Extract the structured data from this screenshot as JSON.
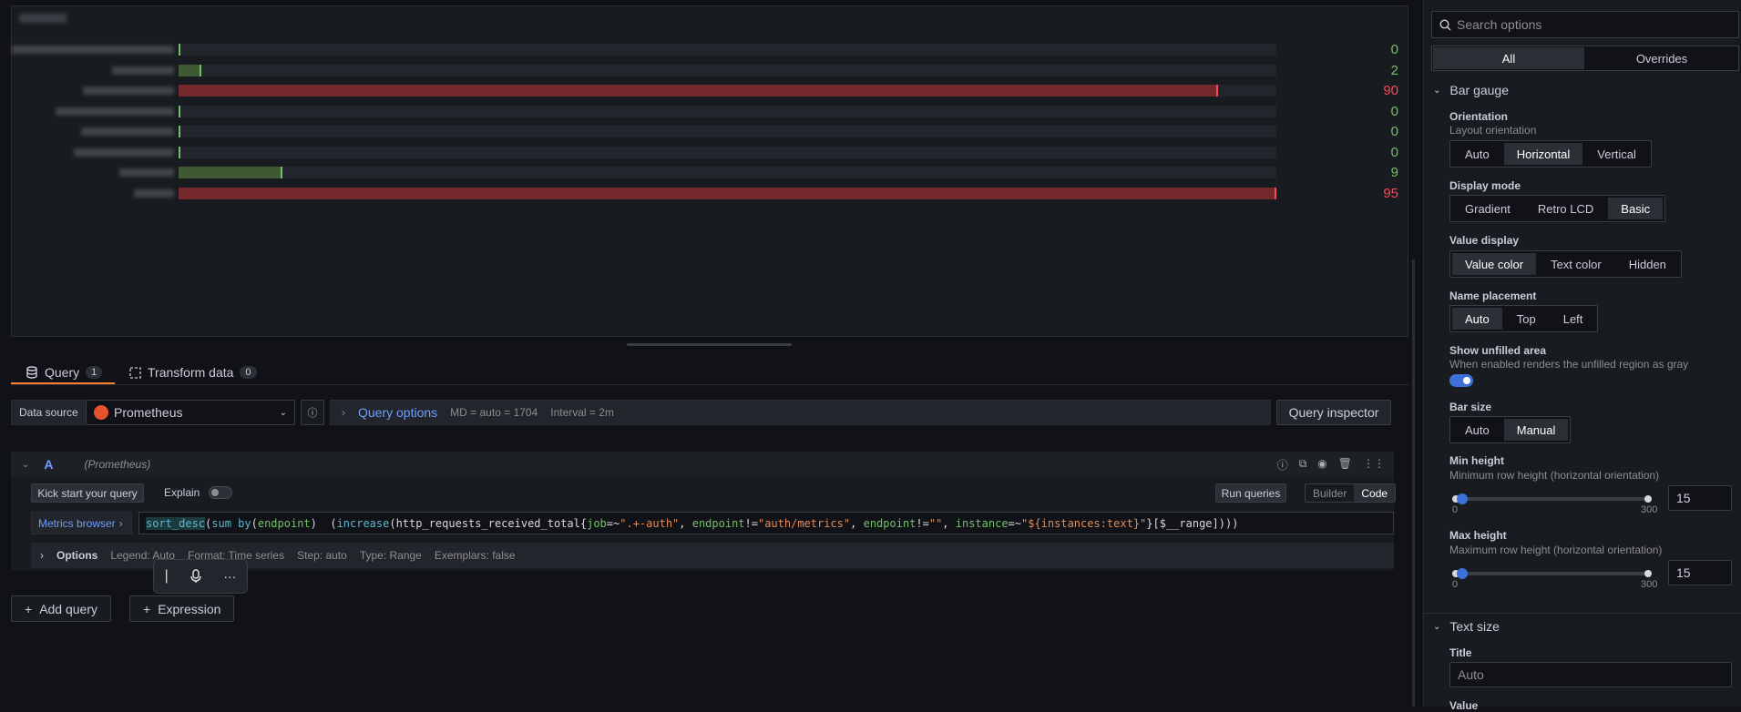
{
  "bars": [
    {
      "value": "0",
      "fraction": 0.0,
      "color": "green"
    },
    {
      "value": "2",
      "fraction": 0.021,
      "color": "green"
    },
    {
      "value": "90",
      "fraction": 0.947,
      "color": "red"
    },
    {
      "value": "0",
      "fraction": 0.0,
      "color": "green"
    },
    {
      "value": "0",
      "fraction": 0.0,
      "color": "green"
    },
    {
      "value": "0",
      "fraction": 0.0,
      "color": "green"
    },
    {
      "value": "9",
      "fraction": 0.095,
      "color": "green"
    },
    {
      "value": "95",
      "fraction": 1.0,
      "color": "red"
    }
  ],
  "tabs": {
    "query_label": "Query",
    "query_count": "1",
    "transform_label": "Transform data",
    "transform_count": "0"
  },
  "datasource": {
    "label": "Data source",
    "name": "Prometheus"
  },
  "query_options": {
    "label": "Query options",
    "md": "MD = auto = 1704",
    "interval": "Interval = 2m"
  },
  "query_inspector": "Query inspector",
  "query_row": {
    "ref": "A",
    "ds": "(Prometheus)",
    "kick_start": "Kick start your query",
    "explain": "Explain",
    "run_queries": "Run queries",
    "builder": "Builder",
    "code": "Code",
    "metrics_browser": "Metrics browser",
    "expr": {
      "p1": "sort_desc",
      "p2": "(",
      "p3": "sum by",
      "p4": "(",
      "p5": "endpoint",
      "p6": ")  (",
      "p7": "increase",
      "p8": "(http_requests_received_total{",
      "p9": "job",
      "p10": "=~",
      "p11": "\".+-auth\"",
      "p12": ", ",
      "p13": "endpoint",
      "p14": "!=",
      "p15": "\"auth/metrics\"",
      "p16": ", ",
      "p17": "endpoint",
      "p18": "!=",
      "p19": "\"\"",
      "p20": ", ",
      "p21": "instance",
      "p22": "=~",
      "p23": "\"${instances:text}\"",
      "p24": "}[$__range])))"
    },
    "options_label": "Options",
    "legend": "Legend: Auto",
    "format": "Format: Time series",
    "step": "Step: auto",
    "type": "Type: Range",
    "exemplars": "Exemplars: false"
  },
  "add_query": "Add query",
  "expression": "Expression",
  "options_pane": {
    "search_placeholder": "Search options",
    "all": "All",
    "overrides": "Overrides",
    "bar_gauge": "Bar gauge",
    "orientation": {
      "label": "Orientation",
      "desc": "Layout orientation",
      "options": [
        "Auto",
        "Horizontal",
        "Vertical"
      ],
      "selected": "Horizontal"
    },
    "display_mode": {
      "label": "Display mode",
      "options": [
        "Gradient",
        "Retro LCD",
        "Basic"
      ],
      "selected": "Basic"
    },
    "value_display": {
      "label": "Value display",
      "options": [
        "Value color",
        "Text color",
        "Hidden"
      ],
      "selected": "Value color"
    },
    "name_placement": {
      "label": "Name placement",
      "options": [
        "Auto",
        "Top",
        "Left"
      ],
      "selected": "Auto"
    },
    "unfilled": {
      "label": "Show unfilled area",
      "desc": "When enabled renders the unfilled region as gray",
      "enabled": true
    },
    "bar_size": {
      "label": "Bar size",
      "options": [
        "Auto",
        "Manual"
      ],
      "selected": "Manual"
    },
    "min_height": {
      "label": "Min height",
      "desc": "Minimum row height (horizontal orientation)",
      "min": "0",
      "max": "300",
      "value": "15"
    },
    "max_height": {
      "label": "Max height",
      "desc": "Maximum row height (horizontal orientation)",
      "min": "0",
      "max": "300",
      "value": "15"
    },
    "text_size": "Text size",
    "title": {
      "label": "Title",
      "placeholder": "Auto"
    },
    "value_label": "Value"
  },
  "colors": {
    "green": "#73bf69",
    "red": "#f2495c",
    "accent": "#3d71d9",
    "tab_underline": "#ff7f2a"
  }
}
